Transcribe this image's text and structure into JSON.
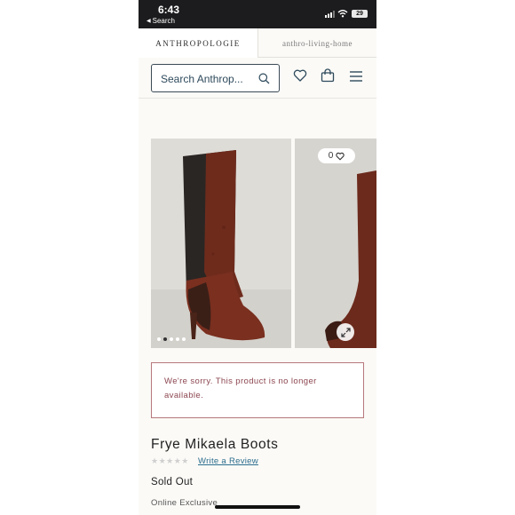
{
  "status_bar": {
    "time": "6:43",
    "back_label": "Search",
    "battery": "29"
  },
  "brand": {
    "main": "ANTHROPOLOGIE",
    "home": "anthro-living-home"
  },
  "search": {
    "placeholder": "Search Anthrop..."
  },
  "gallery": {
    "likes": "0",
    "image_count": 5,
    "active_index": 1
  },
  "notice": {
    "text": "We're sorry. This product is no longer available."
  },
  "product": {
    "title": "Frye Mikaela Boots",
    "stars": "★★★★★",
    "review_link": "Write a Review",
    "status": "Sold Out",
    "exclusive": "Online Exclusive"
  },
  "colors": {
    "notice_text": "#8c4650",
    "notice_border": "#b7787c",
    "link": "#2c6e8e"
  }
}
